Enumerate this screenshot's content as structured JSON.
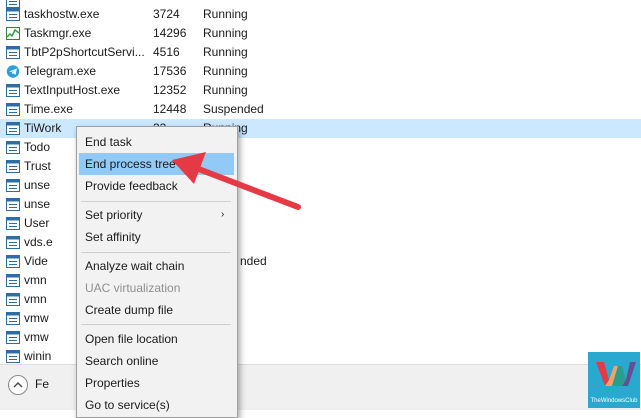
{
  "processes": [
    {
      "name": "",
      "pid": "",
      "status": ""
    },
    {
      "name": "taskhostw.exe",
      "pid": "3724",
      "status": "Running"
    },
    {
      "name": "Taskmgr.exe",
      "pid": "14296",
      "status": "Running"
    },
    {
      "name": "TbtP2pShortcutServi...",
      "pid": "4516",
      "status": "Running"
    },
    {
      "name": "Telegram.exe",
      "pid": "17536",
      "status": "Running"
    },
    {
      "name": "TextInputHost.exe",
      "pid": "12352",
      "status": "Running"
    },
    {
      "name": "Time.exe",
      "pid": "12448",
      "status": "Suspended"
    },
    {
      "name": "TiWork",
      "pid": "33",
      "status": "Running"
    },
    {
      "name": "Todo",
      "pid": "",
      "status": ""
    },
    {
      "name": "Trust",
      "pid": "",
      "status": ""
    },
    {
      "name": "unse",
      "pid": "",
      "status": ""
    },
    {
      "name": "unse",
      "pid": "",
      "status": ""
    },
    {
      "name": "User",
      "pid": "",
      "status": ""
    },
    {
      "name": "vds.e",
      "pid": "",
      "status": ""
    },
    {
      "name": "Vide",
      "pid": "",
      "status": "nded"
    },
    {
      "name": "vmn",
      "pid": "",
      "status": ""
    },
    {
      "name": "vmn",
      "pid": "",
      "status": ""
    },
    {
      "name": "vmw",
      "pid": "",
      "status": ""
    },
    {
      "name": "vmw",
      "pid": "",
      "status": ""
    },
    {
      "name": "winin",
      "pid": "",
      "status": ""
    }
  ],
  "footer": {
    "fewer_details_label": "Fe"
  },
  "context_menu": {
    "items": [
      {
        "label": "End task",
        "enabled": true
      },
      {
        "label": "End process tree",
        "enabled": true,
        "highlighted": true
      },
      {
        "label": "Provide feedback",
        "enabled": true
      },
      {
        "label": "Set priority",
        "enabled": true,
        "submenu": true
      },
      {
        "label": "Set affinity",
        "enabled": true
      },
      {
        "label": "Analyze wait chain",
        "enabled": true
      },
      {
        "label": "UAC virtualization",
        "enabled": false
      },
      {
        "label": "Create dump file",
        "enabled": true
      },
      {
        "label": "Open file location",
        "enabled": true
      },
      {
        "label": "Search online",
        "enabled": true
      },
      {
        "label": "Properties",
        "enabled": true
      },
      {
        "label": "Go to service(s)",
        "enabled": true
      }
    ],
    "submenu_arrow": "›"
  },
  "watermark": {
    "text": "TheWindowsClub"
  },
  "colors": {
    "selection": "#cce8ff",
    "menu_highlight": "#91c9f7",
    "annotation_arrow": "#e63946",
    "logo_bg": "#29a9cf"
  }
}
